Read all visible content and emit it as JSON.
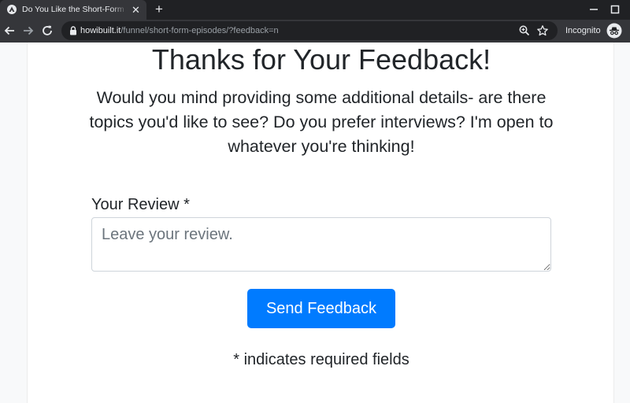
{
  "browser": {
    "tab": {
      "title": "Do You Like the Short-Form Solo Episodes?",
      "favicon": "app-logo-icon",
      "close_icon": "close-icon"
    },
    "new_tab_icon": "plus-icon",
    "window_controls": [
      "minimize-icon",
      "maximize-icon"
    ],
    "nav": {
      "back_icon": "arrow-back-icon",
      "forward_icon": "arrow-forward-icon",
      "reload_icon": "reload-icon"
    },
    "address_bar": {
      "host": "howibuilt.it",
      "path": "/funnel/short-form-episodes/?feedback=n",
      "lock_icon": "lock-icon",
      "zoom_icon": "zoom-icon",
      "bookmark_icon": "star-icon"
    },
    "incognito": {
      "label": "Incognito",
      "icon": "incognito-icon"
    },
    "colors": {
      "tabstrip": "#202124",
      "toolbar": "#35363a",
      "omnibox": "#202124",
      "text": "#e8eaed"
    }
  },
  "page": {
    "title": "Thanks for Your Feedback!",
    "subtitle": "Would you mind providing some additional details- are there topics you'd like to see? Do you prefer interviews? I'm open to whatever you're thinking!",
    "review_label": "Your Review *",
    "review_field": {
      "value": "",
      "placeholder": "Leave your review."
    },
    "send_button": "Send Feedback",
    "required_note": "* indicates required fields",
    "colors": {
      "primary": "#007bff",
      "text": "#212529",
      "placeholder": "#6c757d",
      "field_border": "#ced4da"
    }
  }
}
